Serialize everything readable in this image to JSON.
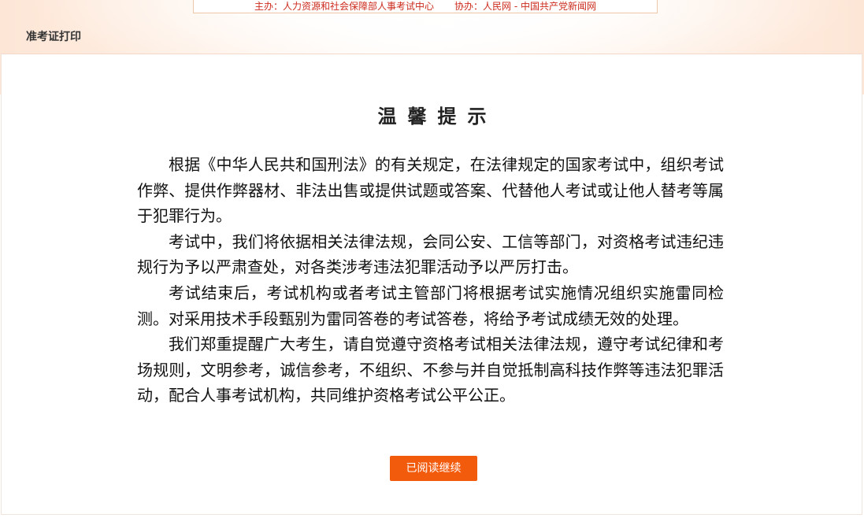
{
  "banner": {
    "host": "主办：人力资源和社会保障部人事考试中心",
    "co_host": "协办：人民网 - 中国共产党新闻网"
  },
  "breadcrumb": {
    "label": "准考证打印"
  },
  "notice": {
    "title": "温馨提示",
    "paragraphs": [
      "根据《中华人民共和国刑法》的有关规定，在法律规定的国家考试中，组织考试作弊、提供作弊器材、非法出售或提供试题或答案、代替他人考试或让他人替考等属于犯罪行为。",
      "考试中，我们将依据相关法律法规，会同公安、工信等部门，对资格考试违纪违规行为予以严肃查处，对各类涉考违法犯罪活动予以严厉打击。",
      "考试结束后，考试机构或者考试主管部门将根据考试实施情况组织实施雷同检测。对采用技术手段甄别为雷同答卷的考试答卷，将给予考试成绩无效的处理。",
      "我们郑重提醒广大考生，请自觉遵守资格考试相关法律法规，遵守考试纪律和考场规则，文明参考，诚信参考，不组织、不参与并自觉抵制高科技作弊等违法犯罪活动，配合人事考试机构，共同维护资格考试公平公正。"
    ],
    "continue_label": "已阅读继续"
  },
  "colors": {
    "accent": "#f25a0c",
    "banner_text": "#cc2c1e",
    "header_tint": "#fde6d6"
  }
}
